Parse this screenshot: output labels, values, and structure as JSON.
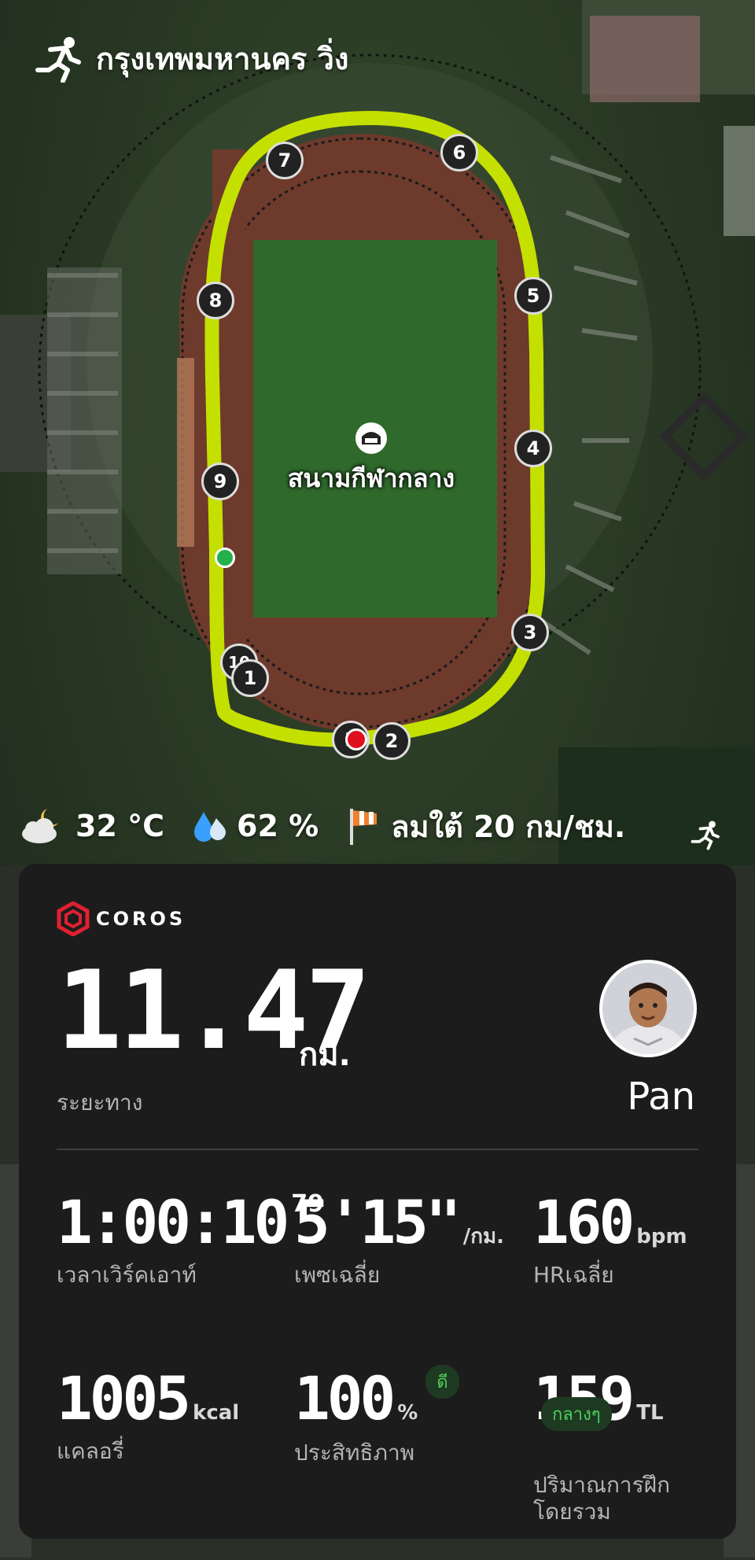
{
  "header": {
    "title": "กรุงเทพมหานคร วิ่ง",
    "icon": "runner-icon"
  },
  "map": {
    "venue_name": "สนามกีฬากลาง",
    "km_markers": [
      "1",
      "2",
      "3",
      "4",
      "5",
      "6",
      "7",
      "8",
      "9",
      "10",
      "1",
      "1"
    ],
    "route_color": "#c4e000",
    "start_color": "#22b14c",
    "end_color": "#e0101e"
  },
  "weather": {
    "temperature": "32 °C",
    "humidity": "62 %",
    "wind": "ลมใต้ 20 กม/ชม."
  },
  "card": {
    "brand": "COROS",
    "distance": {
      "value": "11.47",
      "unit": "กม.",
      "label": "ระยะทาง"
    },
    "user": {
      "name": "Pan"
    },
    "stats": {
      "workout_time": {
        "value": "1:00:10",
        "sup": "79",
        "label": "เวลาเวิร์คเอาท์"
      },
      "pace": {
        "value": "5'15\"",
        "unit": "/กม.",
        "label": "เพซเฉลี่ย"
      },
      "heart_rate": {
        "value": "160",
        "unit": "bpm",
        "label": "HRเฉลี่ย"
      },
      "calories": {
        "value": "1005",
        "unit": "kcal",
        "label": "แคลอรี่"
      },
      "efficiency": {
        "value": "100",
        "unit": "%",
        "badge": "ดี",
        "label": "ประสิทธิภาพ"
      },
      "training_load": {
        "value": "159",
        "unit": "TL",
        "badge": "กลางๆ",
        "label": "ปริมาณการฝึก\nโดยรวม"
      }
    }
  }
}
